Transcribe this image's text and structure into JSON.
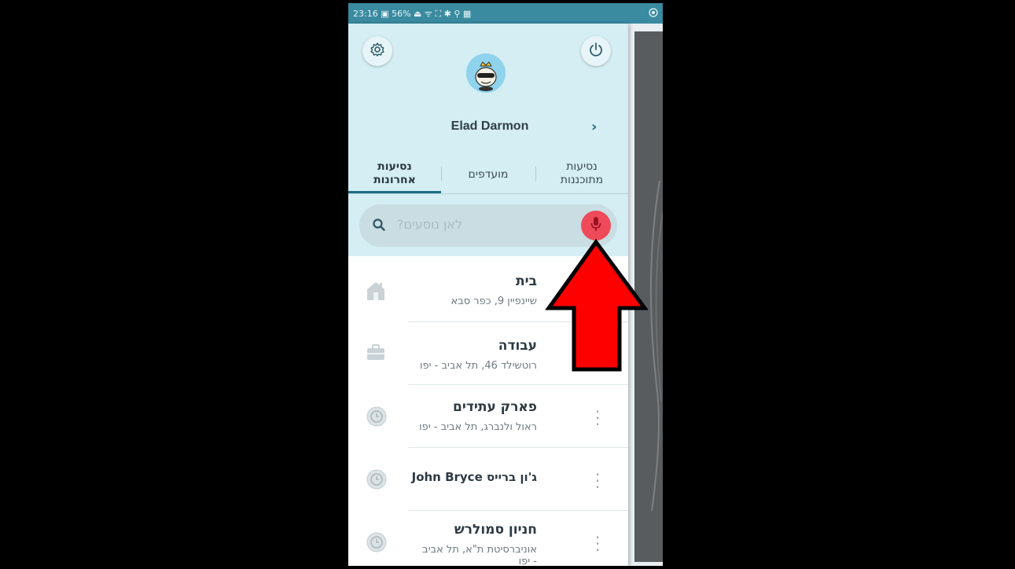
{
  "status_bar": {
    "left_text": "23:16 ▣ 56% ⏏ ᯤ ⛶ ✱ ⚲ ▦",
    "right_icon": "whatsapp-icon"
  },
  "header": {
    "user_name": "Elad Darmon",
    "settings_icon": "gear-icon",
    "power_icon": "power-icon",
    "chevron": "›"
  },
  "tabs": [
    {
      "line1": "נסיעות",
      "line2": "אחרונות"
    },
    {
      "line1": "מועדפים",
      "line2": ""
    },
    {
      "line1": "נסיעות",
      "line2": "מתוכננות"
    }
  ],
  "search": {
    "placeholder": "לאן נוסעים?"
  },
  "list": [
    {
      "icon": "home-icon",
      "title": "בית",
      "subtitle": "שיינפיין 9, כפר סבא"
    },
    {
      "icon": "briefcase-icon",
      "title": "עבודה",
      "subtitle": "רוטשילד 46, תל אביב - יפו"
    },
    {
      "icon": "clock-icon",
      "title": "פארק עתידים",
      "subtitle": "ראול ולנברג, תל אביב - יפו"
    },
    {
      "icon": "clock-icon",
      "title": "ג'ון ברייס John Bryce",
      "subtitle": ""
    },
    {
      "icon": "clock-icon",
      "title": "חניון סמולרש",
      "subtitle": "אוניברסיטת ת\"א, תל אביב - יפו"
    }
  ],
  "colors": {
    "status_bar": "#3a8aa0",
    "header_bg": "#d4eef3",
    "accent": "#1b6f86",
    "mic": "#ef4a5a",
    "annotation_arrow": "#ff0000"
  }
}
